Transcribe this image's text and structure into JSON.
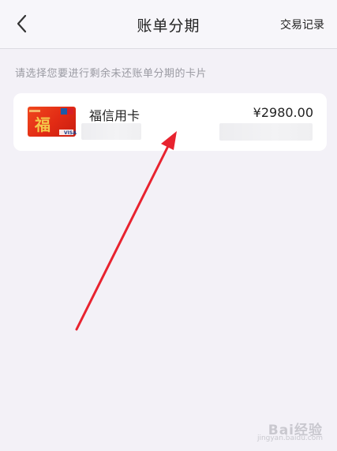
{
  "header": {
    "title": "账单分期",
    "action_label": "交易记录",
    "back_icon": "chevron-left-icon"
  },
  "hint_text": "请选择您要进行剩余未还账单分期的卡片",
  "cards": [
    {
      "name": "福信用卡",
      "amount": "¥2980.00",
      "thumb_char": "福",
      "thumb_brand": "VISA"
    }
  ],
  "watermark": {
    "brand": "Bai经验",
    "sub": "jingyan.baidu.com"
  },
  "colors": {
    "background": "#f3f1f7",
    "card_red": "#e12a14",
    "annotation_arrow": "#e8232f"
  }
}
